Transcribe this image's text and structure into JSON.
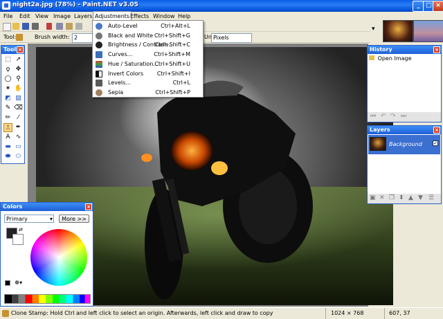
{
  "window": {
    "title": "night2a.jpg (78%) - Paint.NET v3.05"
  },
  "menu": [
    "File",
    "Edit",
    "View",
    "Image",
    "Layers",
    "Adjustments",
    "Effects",
    "Window",
    "Help"
  ],
  "toolbar": {
    "tool_label": "Tool:",
    "brush_width_label": "Brush width:",
    "brush_width_value": "2",
    "units_label": "Units:",
    "units_value": "Pixels"
  },
  "adjustments_menu": [
    {
      "label": "Auto-Level",
      "shortcut": "Ctrl+Alt+L",
      "icon": "auto-level-icon",
      "color": "#4a78c8"
    },
    {
      "label": "Black and White",
      "shortcut": "Ctrl+Shift+G",
      "icon": "black-and-white-icon",
      "color": "#777777"
    },
    {
      "label": "Brightness / Contrast...",
      "shortcut": "Ctrl+Shift+C",
      "icon": "brightness-contrast-icon",
      "color": "#222222"
    },
    {
      "label": "Curves...",
      "shortcut": "Ctrl+Shift+M",
      "icon": "curves-icon",
      "color": "#3a6fb8"
    },
    {
      "label": "Hue / Saturation...",
      "shortcut": "Ctrl+Shift+U",
      "icon": "hue-saturation-icon",
      "color": "#d04030"
    },
    {
      "label": "Invert Colors",
      "shortcut": "Ctrl+Shift+I",
      "icon": "invert-colors-icon",
      "color": "#111111"
    },
    {
      "label": "Levels...",
      "shortcut": "Ctrl+L",
      "icon": "levels-icon",
      "color": "#5a5a5a"
    },
    {
      "label": "Sepia",
      "shortcut": "Ctrl+Shift+P",
      "icon": "sepia-icon",
      "color": "#a08060"
    }
  ],
  "tools_panel": {
    "title": "Tools"
  },
  "colors_panel": {
    "title": "Colors",
    "mode": "Primary",
    "more_button": "More >>"
  },
  "history_panel": {
    "title": "History",
    "items": [
      "Open Image"
    ]
  },
  "layers_panel": {
    "title": "Layers",
    "items": [
      "Background"
    ]
  },
  "status": {
    "hint": "Clone Stamp: Hold Ctrl and left click to select an origin. Afterwards, left click and draw to copy",
    "image_size": "1024 × 768",
    "cursor": "607, 37"
  }
}
